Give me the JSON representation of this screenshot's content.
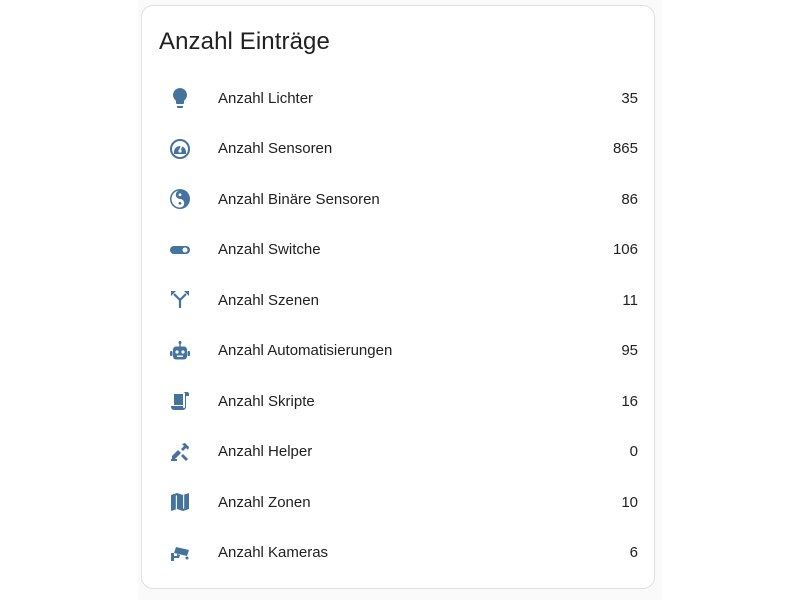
{
  "card": {
    "title": "Anzahl Einträge"
  },
  "accent_color": "#44739e",
  "rows": [
    {
      "icon": "lightbulb-icon",
      "label": "Anzahl Lichter",
      "value": "35"
    },
    {
      "icon": "gauge-icon",
      "label": "Anzahl Sensoren",
      "value": "865"
    },
    {
      "icon": "yin-yang-icon",
      "label": "Anzahl Binäre Sensoren",
      "value": "86"
    },
    {
      "icon": "toggle-switch-icon",
      "label": "Anzahl Switche",
      "value": "106"
    },
    {
      "icon": "source-fork-icon",
      "label": "Anzahl Szenen",
      "value": "11"
    },
    {
      "icon": "robot-icon",
      "label": "Anzahl Automatisierungen",
      "value": "95"
    },
    {
      "icon": "script-icon",
      "label": "Anzahl Skripte",
      "value": "16"
    },
    {
      "icon": "tools-icon",
      "label": "Anzahl Helper",
      "value": "0"
    },
    {
      "icon": "map-icon",
      "label": "Anzahl Zonen",
      "value": "10"
    },
    {
      "icon": "cctv-icon",
      "label": "Anzahl Kameras",
      "value": "6"
    }
  ]
}
